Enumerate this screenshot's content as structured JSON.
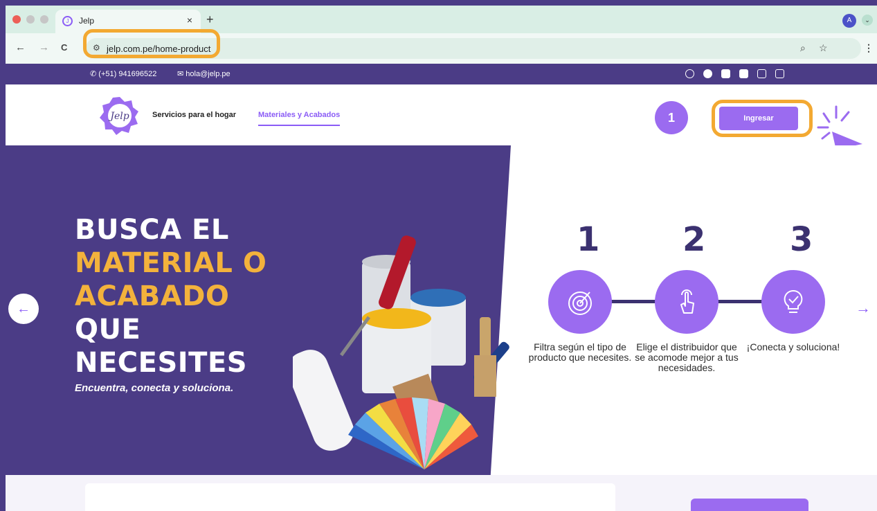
{
  "browser": {
    "tab_title": "Jelp",
    "tab_close": "×",
    "new_tab": "+",
    "back": "←",
    "forward": "→",
    "reload": "C",
    "url": "jelp.com.pe/home-product",
    "zoom_icon": "⌕",
    "bookmark_icon": "☆",
    "avatar_letter": "A",
    "menu_icon": "⋮"
  },
  "topbar": {
    "phone": "(+51) 941696522",
    "email": "hola@jelp.pe"
  },
  "header": {
    "logo_text": "Jelp",
    "nav": [
      "Servicios para el hogar",
      "Materiales y Acabados"
    ],
    "step_badge": "1",
    "login_button": "Ingresar"
  },
  "hero": {
    "title_lines": [
      {
        "text": "BUSCA EL",
        "color": "white"
      },
      {
        "text": "MATERIAL O",
        "color": "yellow"
      },
      {
        "text": "ACABADO",
        "color": "yellow"
      },
      {
        "text": "QUE",
        "color": "white"
      },
      {
        "text": "NECESITES",
        "color": "white"
      }
    ],
    "subtitle": "Encuentra, conecta y soluciona.",
    "prev": "←",
    "next": "→"
  },
  "steps": [
    {
      "number": "1",
      "icon": "target-icon",
      "text": "Filtra según el tipo de producto que necesites."
    },
    {
      "number": "2",
      "icon": "tap-hand-icon",
      "text": "Elige el distribuidor que se acomode mejor a tus necesidades."
    },
    {
      "number": "3",
      "icon": "lightbulb-check-icon",
      "text": "¡Conecta y soluciona!"
    }
  ],
  "colors": {
    "brand_purple": "#4b3c86",
    "accent_purple": "#9b6bf0",
    "highlight_orange": "#f3a932",
    "title_yellow": "#f3b23c"
  }
}
